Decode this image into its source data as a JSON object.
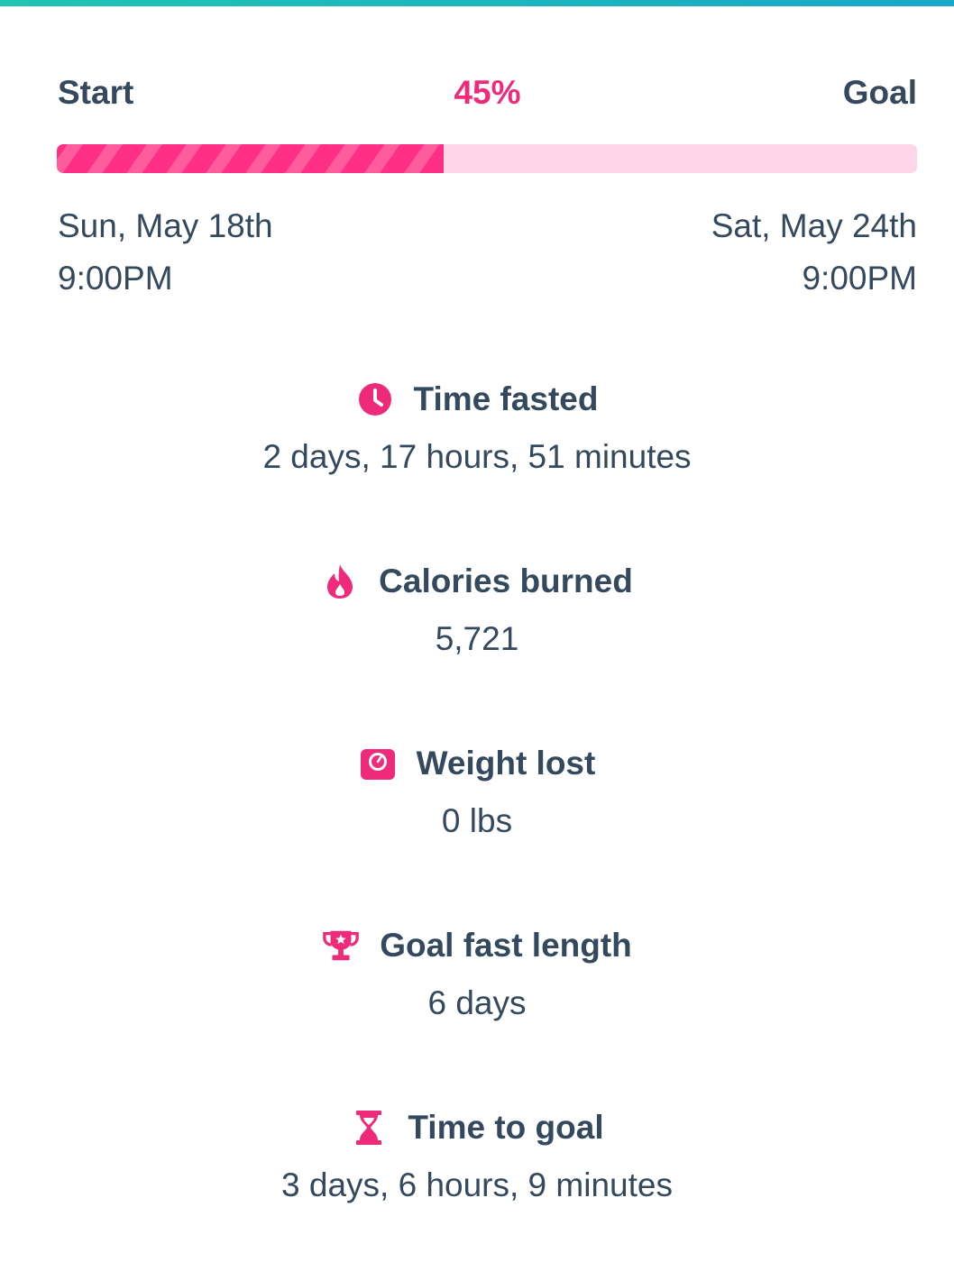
{
  "progress": {
    "start_label": "Start",
    "goal_label": "Goal",
    "percent_label": "45%",
    "percent_value": 0.45,
    "start_date": "Sun, May 18th",
    "start_time": "9:00PM",
    "goal_date": "Sat, May 24th",
    "goal_time": "9:00PM"
  },
  "stats": [
    {
      "icon": "clock-icon",
      "title": "Time fasted",
      "value": "2 days, 17 hours, 51 minutes"
    },
    {
      "icon": "flame-icon",
      "title": "Calories burned",
      "value": "5,721"
    },
    {
      "icon": "scale-icon",
      "title": "Weight lost",
      "value": "0 lbs"
    },
    {
      "icon": "trophy-icon",
      "title": "Goal fast length",
      "value": "6 days"
    },
    {
      "icon": "hourglass-icon",
      "title": "Time to goal",
      "value": "3 days, 6 hours, 9 minutes"
    }
  ],
  "colors": {
    "accent": "#ef2a7b",
    "text": "#34495e",
    "track": "#ffd6e7",
    "top_bar": "#16a9c9"
  }
}
